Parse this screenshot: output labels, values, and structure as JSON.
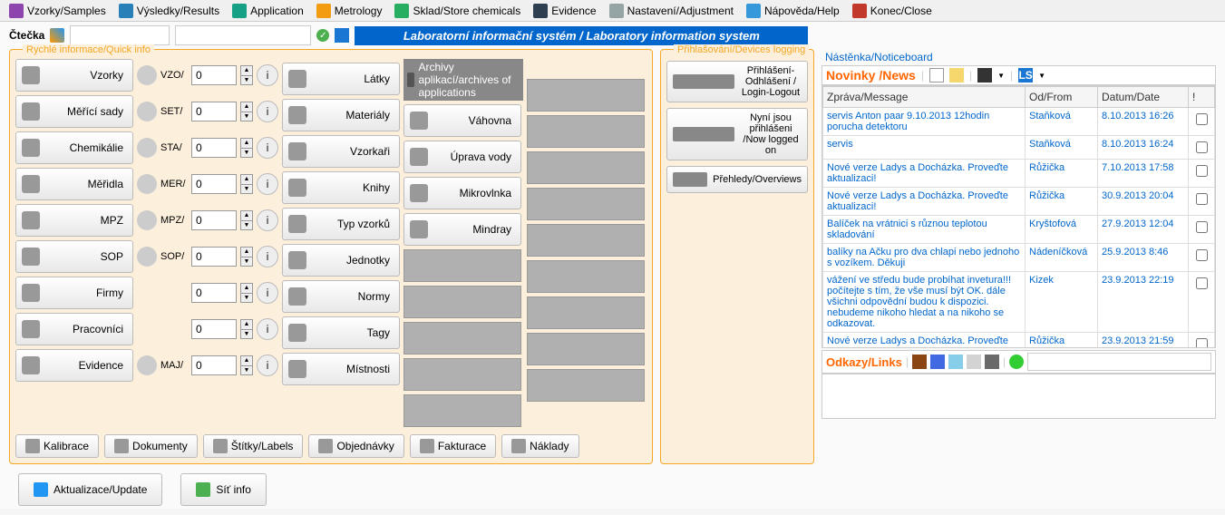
{
  "toolbar": {
    "items": [
      {
        "label": "Vzorky/Samples",
        "color": "#8e44ad"
      },
      {
        "label": "Výsledky/Results",
        "color": "#2980b9"
      },
      {
        "label": "Application",
        "color": "#16a085"
      },
      {
        "label": "Metrology",
        "color": "#f39c12"
      },
      {
        "label": "Sklad/Store chemicals",
        "color": "#27ae60"
      },
      {
        "label": "Evidence",
        "color": "#2c3e50"
      },
      {
        "label": "Nastavení/Adjustment",
        "color": "#95a5a6"
      },
      {
        "label": "Nápověda/Help",
        "color": "#3498db"
      },
      {
        "label": "Konec/Close",
        "color": "#c0392b"
      }
    ]
  },
  "reader": {
    "label": "Čtečka",
    "banner": "Laboratorní informační systém / Laboratory information system"
  },
  "quickinfo": {
    "title": "Rychlé informace/Quick info",
    "archive_title": "Archivy aplikací/archives of applications",
    "col1": [
      {
        "label": "Vzorky"
      },
      {
        "label": "Měřící sady"
      },
      {
        "label": "Chemikálie"
      },
      {
        "label": "Měřidla"
      },
      {
        "label": "MPZ"
      },
      {
        "label": "SOP"
      },
      {
        "label": "Firmy"
      },
      {
        "label": "Pracovníci"
      },
      {
        "label": "Evidence"
      }
    ],
    "col2": [
      {
        "code": "VZO/",
        "val": "0"
      },
      {
        "code": "SET/",
        "val": "0"
      },
      {
        "code": "STA/",
        "val": "0"
      },
      {
        "code": "MER/",
        "val": "0"
      },
      {
        "code": "MPZ/",
        "val": "0"
      },
      {
        "code": "SOP/",
        "val": "0"
      },
      {
        "code": "",
        "val": "0"
      },
      {
        "code": "",
        "val": "0"
      },
      {
        "code": "MAJ/",
        "val": "0"
      }
    ],
    "col3": [
      {
        "label": "Látky"
      },
      {
        "label": "Materiály"
      },
      {
        "label": "Vzorkaři"
      },
      {
        "label": "Knihy"
      },
      {
        "label": "Typ vzorků"
      },
      {
        "label": "Jednotky"
      },
      {
        "label": "Normy"
      },
      {
        "label": "Tagy"
      },
      {
        "label": "Místnosti"
      }
    ],
    "col4": [
      {
        "label": "Váhovna"
      },
      {
        "label": "Úprava vody"
      },
      {
        "label": "Mikrovlnka"
      },
      {
        "label": "Mindray"
      }
    ],
    "bottom": [
      {
        "label": "Kalibrace"
      },
      {
        "label": "Dokumenty"
      },
      {
        "label": "Štítky/Labels"
      },
      {
        "label": "Objednávky"
      },
      {
        "label": "Fakturace"
      },
      {
        "label": "Náklady"
      }
    ]
  },
  "devlog": {
    "title": "Přihlašování/Devices logging",
    "btn1": "Přihlášení-Odhlášení / Login-Logout",
    "btn2": "Nyní jsou přihlášeni /Now logged on",
    "btn3": "Přehledy/Overviews"
  },
  "notice": {
    "title": "Nástěnka/Noticeboard",
    "news_title": "Novinky /News",
    "headers": {
      "msg": "Zpráva/Message",
      "from": "Od/From",
      "date": "Datum/Date",
      "ex": "!"
    },
    "rows": [
      {
        "msg": "servis Anton paar 9.10.2013 12hodin porucha detektoru",
        "from": "Staňková",
        "date": "8.10.2013 16:26"
      },
      {
        "msg": "servis",
        "from": "Staňková",
        "date": "8.10.2013 16:24"
      },
      {
        "msg": "Nové verze Ladys a Docházka. Proveďte aktualizaci!",
        "from": "Růžička",
        "date": "7.10.2013 17:58"
      },
      {
        "msg": "Nové verze Ladys a Docházka. Proveďte aktualizaci!",
        "from": "Růžička",
        "date": "30.9.2013 20:04"
      },
      {
        "msg": "Balíček na vrátnici s různou teplotou skladování",
        "from": "Kryštofová",
        "date": "27.9.2013 12:04"
      },
      {
        "msg": "balíky na Ačku pro dva chlapi nebo jednoho s vozíkem. Děkuji",
        "from": "Nádeníčková",
        "date": "25.9.2013 8:46"
      },
      {
        "msg": "vážení ve středu bude probíhat invetura!!! počítejte s tím, že vše musí být OK. dále všichni odpovědní budou k dispozici. nebudeme nikoho hledat a na nikoho se odkazovat.",
        "from": "Kizek",
        "date": "23.9.2013 22:19"
      },
      {
        "msg": "Nové verze Ladys a Docházka. Proveďte aktualizaci!",
        "from": "Růžička",
        "date": "23.9.2013 21:59"
      }
    ],
    "links_title": "Odkazy/Links"
  },
  "bottom": {
    "update": "Aktualizace/Update",
    "netinfo": "Síť info"
  }
}
